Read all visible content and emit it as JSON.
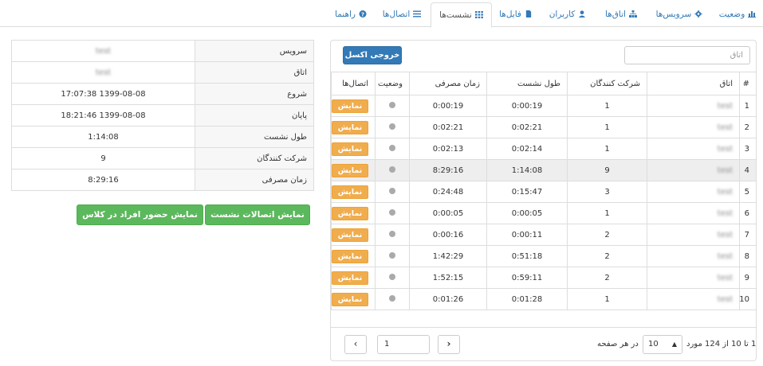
{
  "tabs": [
    {
      "label": "وضعیت",
      "icon": "bar-chart-icon",
      "active": false
    },
    {
      "label": "سرویس‌ها",
      "icon": "gear-icon",
      "active": false
    },
    {
      "label": "اتاق‌ها",
      "icon": "sitemap-icon",
      "active": false
    },
    {
      "label": "کاربران",
      "icon": "user-icon",
      "active": false
    },
    {
      "label": "فایل‌ها",
      "icon": "file-icon",
      "active": false
    },
    {
      "label": "نشست‌ها",
      "icon": "grid-icon",
      "active": true
    },
    {
      "label": "اتصال‌ها",
      "icon": "list-icon",
      "active": false
    },
    {
      "label": "راهنما",
      "icon": "question-circle-icon",
      "active": false
    }
  ],
  "colors": {
    "primary": "#337ab7",
    "warning": "#f0ad4e",
    "success": "#5cb85c",
    "status_dot": "#aaaaaa",
    "selected_row": "#eeeeee"
  },
  "toolbar": {
    "excel_label": "خروجی اکسل",
    "search_placeholder": "اتاق"
  },
  "table": {
    "headers": {
      "index": "#",
      "room": "اتاق",
      "participants": "شرکت کنندگان",
      "duration": "طول نشست",
      "used_time": "زمان مصرفی",
      "status": "وضعیت",
      "connections": "اتصال‌ها"
    },
    "show_label": "نمایش",
    "rows": [
      {
        "index": "1",
        "room": "test",
        "participants": "1",
        "duration": "0:00:19",
        "used_time": "0:00:19"
      },
      {
        "index": "2",
        "room": "test",
        "participants": "1",
        "duration": "0:02:21",
        "used_time": "0:02:21"
      },
      {
        "index": "3",
        "room": "test",
        "participants": "1",
        "duration": "0:02:14",
        "used_time": "0:02:13"
      },
      {
        "index": "4",
        "room": "test",
        "participants": "9",
        "duration": "1:14:08",
        "used_time": "8:29:16",
        "selected": true
      },
      {
        "index": "5",
        "room": "test",
        "participants": "3",
        "duration": "0:15:47",
        "used_time": "0:24:48"
      },
      {
        "index": "6",
        "room": "test",
        "participants": "1",
        "duration": "0:00:05",
        "used_time": "0:00:05"
      },
      {
        "index": "7",
        "room": "test",
        "participants": "2",
        "duration": "0:00:11",
        "used_time": "0:00:16"
      },
      {
        "index": "8",
        "room": "test",
        "participants": "2",
        "duration": "0:51:18",
        "used_time": "1:42:29"
      },
      {
        "index": "9",
        "room": "test",
        "participants": "2",
        "duration": "0:59:11",
        "used_time": "1:52:15"
      },
      {
        "index": "10",
        "room": "test",
        "participants": "1",
        "duration": "0:01:28",
        "used_time": "0:01:26"
      }
    ]
  },
  "pagination": {
    "summary": "1 تا 10 از 124 مورد",
    "per_page_label": "در هر صفحه",
    "per_page_value": "10",
    "page_value": "1",
    "next_glyph": "›",
    "prev_glyph": "‹",
    "caret_glyph": "▲"
  },
  "details": {
    "rows": [
      {
        "key": "سرویس",
        "value": "test"
      },
      {
        "key": "اتاق",
        "value": "test"
      },
      {
        "key": "شروع",
        "value": "1399-08-08 17:07:38"
      },
      {
        "key": "پایان",
        "value": "1399-08-08 18:21:46"
      },
      {
        "key": "طول نشست",
        "value": "1:14:08"
      },
      {
        "key": "شرکت کنندگان",
        "value": "9"
      },
      {
        "key": "زمان مصرفی",
        "value": "8:29:16"
      }
    ]
  },
  "actions": {
    "show_connections": "نمایش اتصالات نشست",
    "show_attendance": "نمایش حضور افراد در کلاس"
  }
}
